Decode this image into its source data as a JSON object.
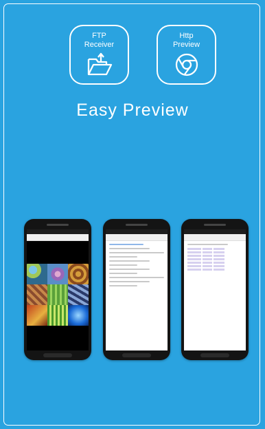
{
  "ftp_icon": {
    "line1": "FTP",
    "line2": "Receiver"
  },
  "http_icon": {
    "line1": "Http",
    "line2": "Preview"
  },
  "title": "Easy Preview",
  "colors": {
    "background": "#2aa3e0",
    "foreground": "#ffffff"
  }
}
